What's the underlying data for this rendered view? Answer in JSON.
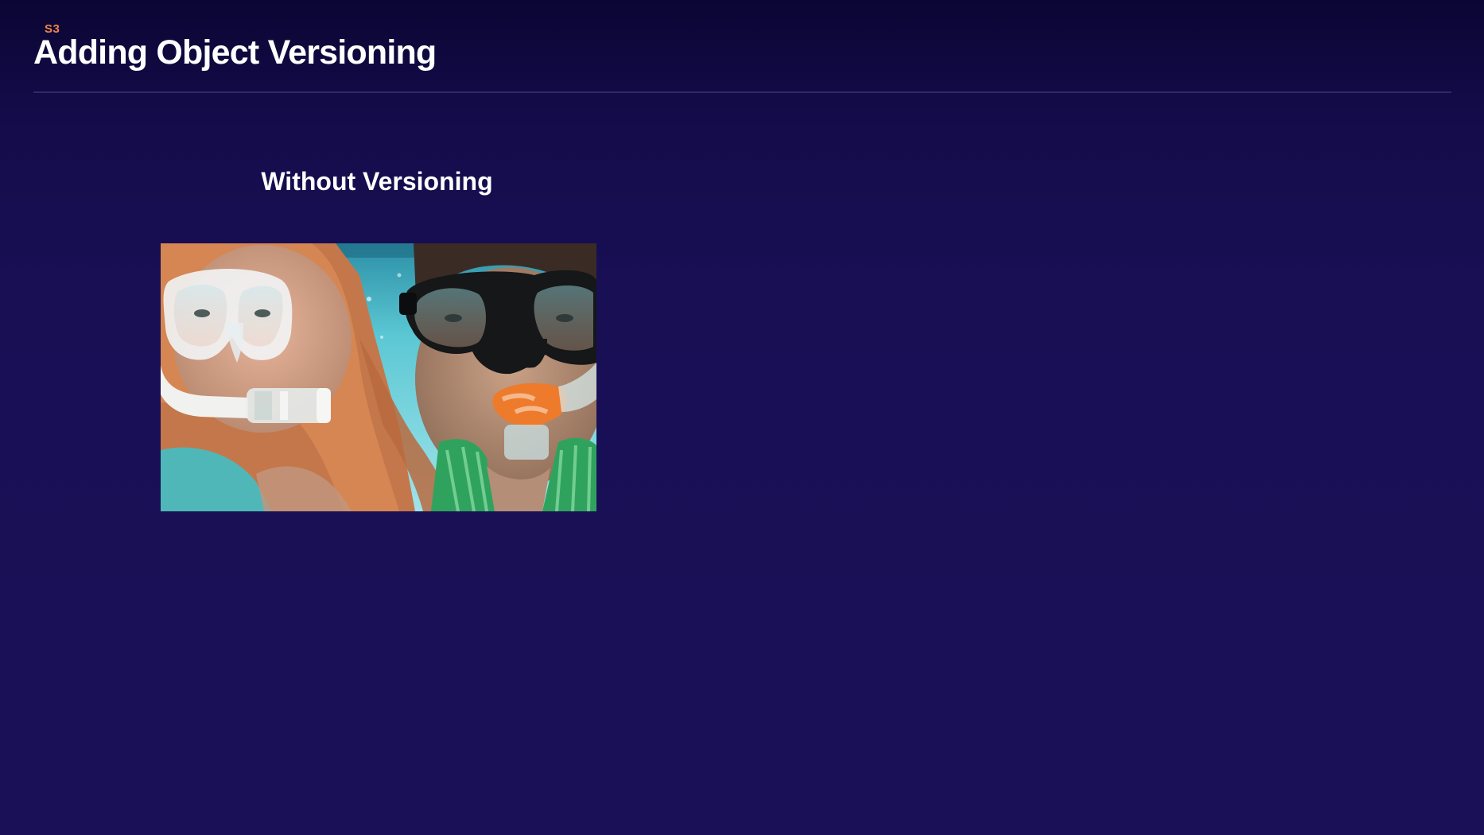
{
  "header": {
    "section_tag": "S3",
    "title": "Adding Object Versioning"
  },
  "content": {
    "subheading": "Without Versioning",
    "photo": {
      "subject": "underwater-snorkelers-photo"
    }
  },
  "colors": {
    "background_top": "#0b0533",
    "background_bottom": "#1a1058",
    "accent": "#f0854a",
    "divider": "#2e2a6e",
    "text": "#ffffff"
  }
}
